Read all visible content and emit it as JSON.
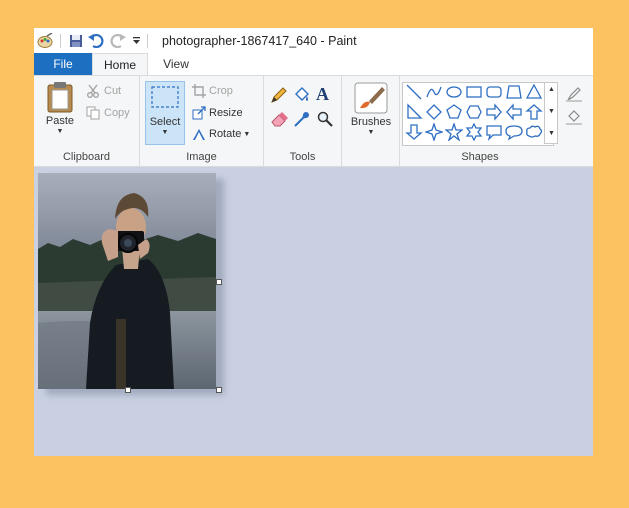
{
  "window": {
    "title": "photographer-1867417_640 - Paint"
  },
  "tabs": [
    {
      "label": "File"
    },
    {
      "label": "Home"
    },
    {
      "label": "View"
    }
  ],
  "ribbon": {
    "clipboard": {
      "label": "Clipboard",
      "paste": "Paste",
      "cut": "Cut",
      "copy": "Copy"
    },
    "image": {
      "label": "Image",
      "select": "Select",
      "crop": "Crop",
      "resize": "Resize",
      "rotate": "Rotate"
    },
    "tools": {
      "label": "Tools"
    },
    "brushes": {
      "label": "Brushes"
    },
    "shapes": {
      "label": "Shapes"
    }
  },
  "colors": {
    "background": "#fbc25f",
    "file_tab": "#1d6fc1",
    "canvas_bg": "#c9d0e1",
    "select_highlight": "#cce4f7"
  }
}
